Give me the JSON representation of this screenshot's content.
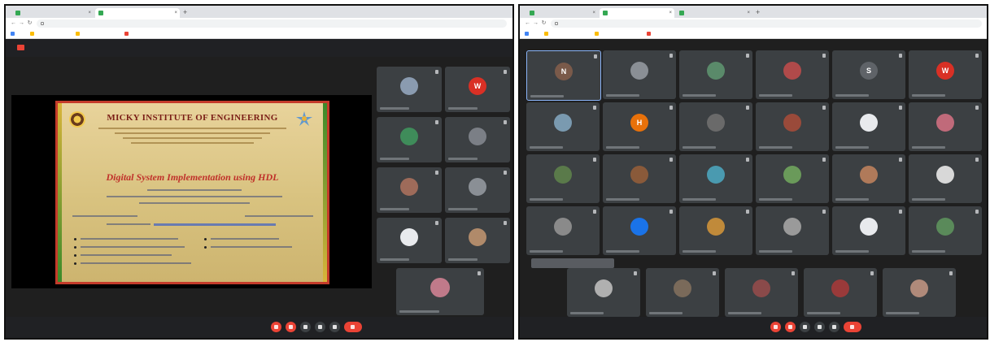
{
  "colors": {
    "browser_chrome": "#dfe1e5",
    "meet_background": "#1f1f1f",
    "tile_background": "#3c4043",
    "end_call_red": "#ea4335",
    "poster_title": "#7a1e16",
    "poster_headline": "#c0302a"
  },
  "left_window": {
    "tabs": [
      {
        "label": "",
        "icon": "meet-favicon",
        "active": false
      },
      {
        "label": "",
        "icon": "meet-favicon",
        "active": true
      }
    ],
    "address": "",
    "bookmarks": [
      {
        "label": "",
        "icon": "apps-icon"
      },
      {
        "label": "",
        "icon": "bookmark-icon"
      },
      {
        "label": "",
        "icon": "bookmark-icon"
      },
      {
        "label": "",
        "icon": "youtube-icon"
      }
    ],
    "presenting_banner": "",
    "poster": {
      "institute": "MICKY INSTITUTE OF ENGINEERING",
      "workshop_kind": "",
      "on": "",
      "headline": "Digital System Implementation using HDL"
    },
    "tiles": [
      {
        "avatar": "",
        "avatar_color": "#8a9bb0"
      },
      {
        "avatar": "W",
        "avatar_color": "#d93025"
      },
      {
        "avatar": "",
        "avatar_color": "#3f8c5a"
      },
      {
        "avatar": "",
        "avatar_color": "#7b7f86"
      },
      {
        "avatar": "",
        "avatar_color": "#9e6b5a"
      },
      {
        "avatar": "",
        "avatar_color": "#8a8f95"
      },
      {
        "avatar": "",
        "avatar_color": "#e8eaed"
      },
      {
        "avatar": "",
        "avatar_color": "#b08a6a"
      },
      {
        "avatar": "",
        "avatar_color": "#c07a8a"
      }
    ],
    "bottom": {
      "clock": "",
      "meeting_code": ""
    }
  },
  "right_window": {
    "tabs": [
      {
        "label": "",
        "icon": "meet-favicon",
        "active": false
      },
      {
        "label": "",
        "icon": "meet-favicon",
        "active": true
      },
      {
        "label": "",
        "icon": "meet-favicon",
        "active": false
      }
    ],
    "address": "",
    "bookmarks": [
      {
        "label": "",
        "icon": "apps-icon"
      },
      {
        "label": "",
        "icon": "bookmark-icon"
      },
      {
        "label": "",
        "icon": "bookmark-icon"
      },
      {
        "label": "",
        "icon": "youtube-icon"
      }
    ],
    "tiles": [
      {
        "avatar": "N",
        "avatar_color": "#7a5a4a"
      },
      {
        "avatar": "",
        "avatar_color": "#8a8f95"
      },
      {
        "avatar": "",
        "avatar_color": "#5a8a6a"
      },
      {
        "avatar": "",
        "avatar_color": "#b04a4a"
      },
      {
        "avatar": "S",
        "avatar_color": "#5f6368"
      },
      {
        "avatar": "W",
        "avatar_color": "#d93025"
      },
      {
        "avatar": "",
        "avatar_color": "#7a9ab0"
      },
      {
        "avatar": "H",
        "avatar_color": "#e8710a"
      },
      {
        "avatar": "",
        "avatar_color": "#6a6a6a"
      },
      {
        "avatar": "",
        "avatar_color": "#9a4a3a"
      },
      {
        "avatar": "",
        "avatar_color": "#e8eaed"
      },
      {
        "avatar": "",
        "avatar_color": "#c06a7a"
      },
      {
        "avatar": "",
        "avatar_color": "#5a7a4a"
      },
      {
        "avatar": "",
        "avatar_color": "#8a5a3a"
      },
      {
        "avatar": "",
        "avatar_color": "#4a9ab0"
      },
      {
        "avatar": "",
        "avatar_color": "#6a9a5a"
      },
      {
        "avatar": "",
        "avatar_color": "#b07a5a"
      },
      {
        "avatar": "",
        "avatar_color": "#d8d8d8"
      },
      {
        "avatar": "",
        "avatar_color": "#8a8a8a"
      },
      {
        "avatar": "",
        "avatar_color": "#1a73e8"
      },
      {
        "avatar": "",
        "avatar_color": "#c08a3a"
      },
      {
        "avatar": "",
        "avatar_color": "#9a9a9a"
      },
      {
        "avatar": "",
        "avatar_color": "#e8eaed"
      },
      {
        "avatar": "",
        "avatar_color": "#5a8a5a"
      },
      {
        "avatar": "",
        "avatar_color": "#b0b0b0"
      },
      {
        "avatar": "",
        "avatar_color": "#7a6a5a"
      },
      {
        "avatar": "",
        "avatar_color": "#8a4a4a"
      },
      {
        "avatar": "",
        "avatar_color": "#9a3a3a"
      },
      {
        "avatar": "",
        "avatar_color": "#b08a7a"
      }
    ],
    "tooltip": "",
    "bottom": {
      "clock": "",
      "meeting_code": ""
    }
  }
}
